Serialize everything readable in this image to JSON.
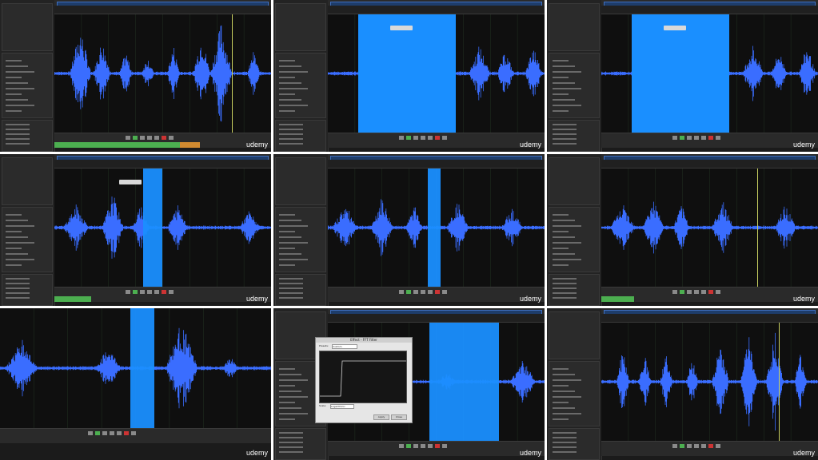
{
  "watermark": "udemy",
  "colors": {
    "waveform": "#3a6dff",
    "selection": "#1a8fff",
    "panel_bg": "#1b1b1b",
    "green_meter": "#4caf50",
    "orange_meter": "#d08a30"
  },
  "dialog": {
    "title": "Effect - FFT Filter",
    "preset_label": "Presets:",
    "preset_value": "Custom",
    "scale_label": "Scale:",
    "scale_value": "Logarithmic",
    "apply_label": "Apply",
    "close_label": "Close"
  },
  "panels": [
    {
      "id": "p1",
      "selection": null,
      "level": "green-orange",
      "playhead": true
    },
    {
      "id": "p2",
      "selection": "wide",
      "level": null,
      "playhead": false
    },
    {
      "id": "p3",
      "selection": "wide",
      "level": null,
      "playhead": false
    },
    {
      "id": "p4",
      "selection": "narrow",
      "level": "green",
      "playhead": false
    },
    {
      "id": "p5",
      "selection": "thin",
      "level": null,
      "playhead": false
    },
    {
      "id": "p6",
      "selection": null,
      "level": "green",
      "playhead": true
    },
    {
      "id": "p7",
      "selection": "zoom",
      "level": null,
      "playhead": false
    },
    {
      "id": "p8",
      "selection": "dialog",
      "level": null,
      "playhead": false
    },
    {
      "id": "p9",
      "selection": null,
      "level": null,
      "playhead": true
    }
  ]
}
